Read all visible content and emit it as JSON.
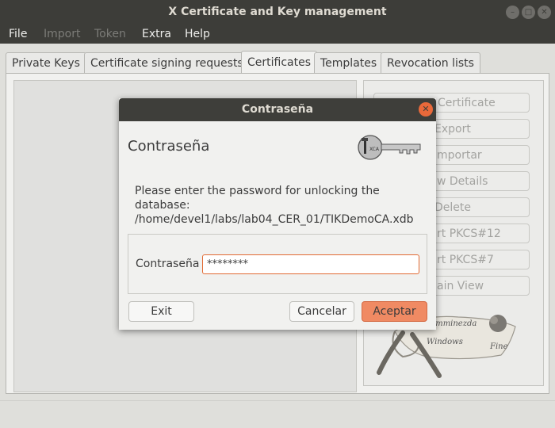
{
  "window": {
    "title": "X Certificate and Key management",
    "controls": {
      "minimize": "–",
      "maximize": "□",
      "close": "✕"
    }
  },
  "menubar": {
    "items": [
      {
        "label": "File",
        "enabled": true
      },
      {
        "label": "Import",
        "enabled": false
      },
      {
        "label": "Token",
        "enabled": false
      },
      {
        "label": "Extra",
        "enabled": true
      },
      {
        "label": "Help",
        "enabled": true
      }
    ]
  },
  "tabs": [
    {
      "label": "Private Keys",
      "active": false
    },
    {
      "label": "Certificate signing requests",
      "active": false
    },
    {
      "label": "Certificates",
      "active": true
    },
    {
      "label": "Templates",
      "active": false
    },
    {
      "label": "Revocation lists",
      "active": false
    }
  ],
  "side_buttons": [
    "Certificate",
    "Export",
    "mportar",
    "w Details",
    "Delete",
    "rt PKCS#12",
    "rt PKCS#7",
    "ain View"
  ],
  "logo": {
    "text": [
      "Jimminezda",
      "Windows",
      "Fine"
    ]
  },
  "dialog": {
    "title": "Contraseña",
    "heading": "Contraseña",
    "message_line1": "Please enter the password for unlocking the database:",
    "message_line2": "/home/devel1/labs/lab04_CER_01/TIKDemoCA.xdb",
    "password_label": "Contraseña",
    "password_value": "********",
    "buttons": {
      "exit": "Exit",
      "cancel": "Cancelar",
      "accept": "Aceptar"
    },
    "close_glyph": "✕"
  },
  "colors": {
    "accent": "#f08a63",
    "titlebar": "#3d3d39",
    "focus": "#e26a33"
  }
}
